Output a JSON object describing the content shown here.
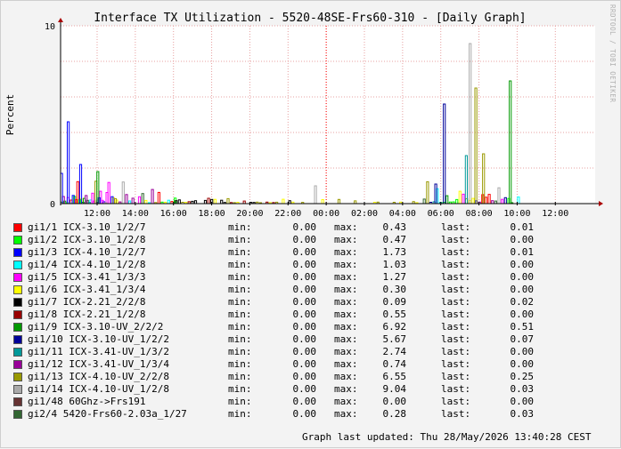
{
  "chart_data": {
    "type": "bar",
    "title": "Interface TX Utilization - 5520-48SE-Frs60-310 - [Daily Graph]",
    "ylabel": "Percent",
    "xlabel": "",
    "ylim": [
      0,
      10
    ],
    "y_ticks": [
      "0",
      "10"
    ],
    "x_ticks": [
      "12:00",
      "14:00",
      "16:00",
      "18:00",
      "20:00",
      "22:00",
      "00:00",
      "02:00",
      "04:00",
      "06:00",
      "08:00",
      "10:00",
      "12:00"
    ],
    "grid": true,
    "side_label": "RRDTOOL / TOBI OETIKER",
    "series": [
      {
        "name": "gi1/1 ICX-3.10_1/2/7",
        "color": "#ff0000",
        "min": "0.00",
        "max": "0.43",
        "last": "0.01"
      },
      {
        "name": "gi1/2 ICX-3.10_1/2/8",
        "color": "#00ff00",
        "min": "0.00",
        "max": "0.47",
        "last": "0.00"
      },
      {
        "name": "gi1/3 ICX-4.10_1/2/7",
        "color": "#0000ff",
        "min": "0.00",
        "max": "1.73",
        "last": "0.01"
      },
      {
        "name": "gi1/4 ICX-4.10_1/2/8",
        "color": "#00ffff",
        "min": "0.00",
        "max": "1.03",
        "last": "0.00"
      },
      {
        "name": "gi1/5 ICX-3.41_1/3/3",
        "color": "#ff00ff",
        "min": "0.00",
        "max": "1.27",
        "last": "0.00"
      },
      {
        "name": "gi1/6 ICX-3.41_1/3/4",
        "color": "#ffff00",
        "min": "0.00",
        "max": "0.30",
        "last": "0.00"
      },
      {
        "name": "gi1/7 ICX-2.21_2/2/8",
        "color": "#000000",
        "min": "0.00",
        "max": "0.09",
        "last": "0.02"
      },
      {
        "name": "gi1/8 ICX-2.21_1/2/8",
        "color": "#990000",
        "min": "0.00",
        "max": "0.55",
        "last": "0.00"
      },
      {
        "name": "gi1/9 ICX-3.10-UV_2/2/2",
        "color": "#009900",
        "min": "0.00",
        "max": "6.92",
        "last": "0.51"
      },
      {
        "name": "gi1/10 ICX-3.10-UV_1/2/2",
        "color": "#000099",
        "min": "0.00",
        "max": "5.67",
        "last": "0.07"
      },
      {
        "name": "gi1/11 ICX-3.41-UV_1/3/2",
        "color": "#009999",
        "min": "0.00",
        "max": "2.74",
        "last": "0.00"
      },
      {
        "name": "gi1/12 ICX-3.41-UV_1/3/4",
        "color": "#990099",
        "min": "0.00",
        "max": "0.74",
        "last": "0.00"
      },
      {
        "name": "gi1/13 ICX-4.10-UV_2/2/8",
        "color": "#999900",
        "min": "0.00",
        "max": "6.55",
        "last": "0.25"
      },
      {
        "name": "gi1/14 ICX-4.10-UV_1/2/8",
        "color": "#aaaaaa",
        "min": "0.00",
        "max": "9.04",
        "last": "0.03"
      },
      {
        "name": "gi1/48 60Ghz->Frs191",
        "color": "#663333",
        "min": "0.00",
        "max": "0.00",
        "last": "0.00"
      },
      {
        "name": "gi2/4 5420-Frs60-2.03a_1/27",
        "color": "#336633",
        "min": "0.00",
        "max": "0.28",
        "last": "0.03"
      }
    ],
    "peaks": [
      {
        "series": 2,
        "hour": 11.35,
        "value": 4.6
      },
      {
        "series": 2,
        "hour": 12.0,
        "value": 2.2
      },
      {
        "series": 2,
        "hour": 11.0,
        "value": 1.7
      },
      {
        "series": 9,
        "hour": 7.05,
        "value": 5.6
      },
      {
        "series": 9,
        "hour": 6.6,
        "value": 1.1
      },
      {
        "series": 10,
        "hour": 8.2,
        "value": 2.7
      },
      {
        "series": 13,
        "hour": 8.4,
        "value": 9.0
      },
      {
        "series": 12,
        "hour": 8.7,
        "value": 6.5
      },
      {
        "series": 12,
        "hour": 9.1,
        "value": 2.8
      },
      {
        "series": 8,
        "hour": 10.5,
        "value": 6.9
      },
      {
        "series": 8,
        "hour": 12.9,
        "value": 1.8
      },
      {
        "series": 13,
        "hour": 0.3,
        "value": 1.0
      }
    ]
  },
  "legend_labels": {
    "min": "min:",
    "max": "max:",
    "last": "last:"
  },
  "footer": {
    "updated": "Graph last updated: Thu 28/May/2026 13:40:28 CEST"
  }
}
